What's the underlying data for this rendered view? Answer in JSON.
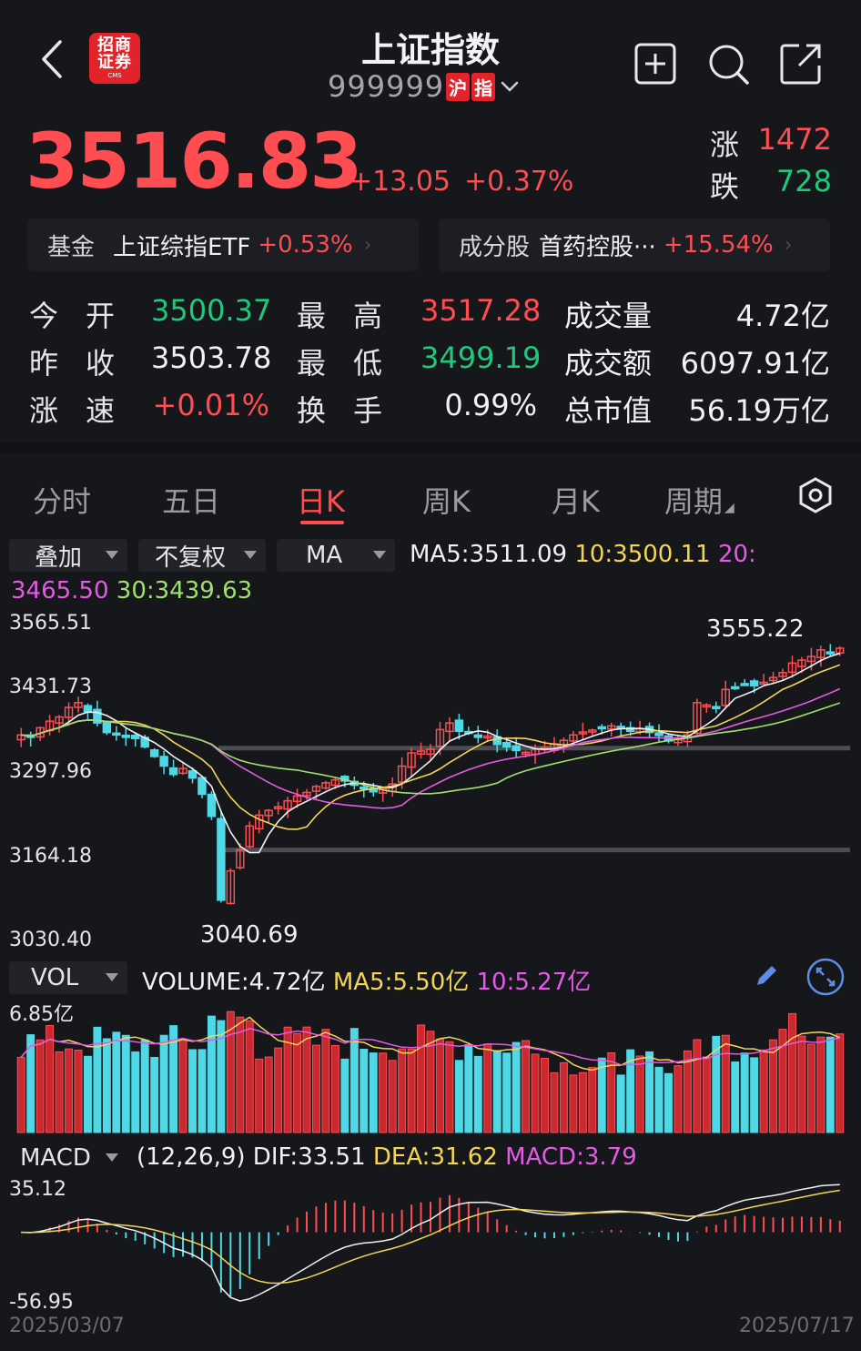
{
  "header": {
    "title": "上证指数",
    "code": "999999",
    "tag1": "沪",
    "tag2": "指",
    "logo_line1": "招商",
    "logo_line2": "证券",
    "logo_small": "CMS"
  },
  "quote": {
    "price": "3516.83",
    "change": "+13.05",
    "change_pct": "+0.37%",
    "up_label": "涨",
    "up_count": "1472",
    "down_label": "跌",
    "down_count": "728"
  },
  "fund": {
    "left_key": "基金",
    "left_name": "上证综指ETF",
    "left_value": "+0.53%",
    "right_key": "成分股",
    "right_name": "首药控股···",
    "right_value": "+15.54%"
  },
  "stats": {
    "open_label": "今开",
    "open_value": "3500.37",
    "high_label": "最高",
    "high_value": "3517.28",
    "vol_label": "成交量",
    "vol_value": "4.72亿",
    "prev_label": "昨收",
    "prev_value": "3503.78",
    "low_label": "最低",
    "low_value": "3499.19",
    "amount_label": "成交额",
    "amount_value": "6097.91亿",
    "speed_label": "涨速",
    "speed_value": "+0.01%",
    "turnover_label": "换手",
    "turnover_value": "0.99%",
    "mcap_label": "总市值",
    "mcap_value": "56.19万亿"
  },
  "tabs": [
    "分时",
    "五日",
    "日K",
    "周K",
    "月K",
    "周期"
  ],
  "active_tab": "日K",
  "kline_controls": {
    "overlay": "叠加",
    "adjust": "不复权",
    "ma": "MA",
    "ma5_label": "MA5:",
    "ma5_value": "3511.09",
    "ma10_label": "10:",
    "ma10_value": "3500.11",
    "ma20_label": "20:",
    "ma20_value": "3465.50",
    "ma30_label": "30:",
    "ma30_value": "3439.63"
  },
  "price_axis": [
    "3565.51",
    "3431.73",
    "3297.96",
    "3164.18",
    "3030.40"
  ],
  "price_annotations": {
    "high": "3555.22",
    "low": "3040.69"
  },
  "volume_panel": {
    "selector": "VOL",
    "volume_label": "VOLUME:",
    "volume_value": "4.72亿",
    "ma5_label": "MA5:",
    "ma5_value": "5.50亿",
    "ma10_label": "10:",
    "ma10_value": "5.27亿",
    "axis_top": "6.85亿"
  },
  "macd_panel": {
    "selector": "MACD",
    "params": "(12,26,9)",
    "dif_label": "DIF:",
    "dif_value": "33.51",
    "dea_label": "DEA:",
    "dea_value": "31.62",
    "macd_label": "MACD:",
    "macd_value": "3.79",
    "axis_top": "35.12",
    "axis_bottom": "-56.95"
  },
  "dates": {
    "start": "2025/03/07",
    "end": "2025/07/17"
  },
  "colors": {
    "up": "#ff4d52",
    "down": "#21c77a",
    "candle_down": "#4fd8e6",
    "ma5": "#f1f1f3",
    "ma10": "#f3d55a",
    "ma20": "#e45ae6",
    "ma30": "#9ee06e",
    "background": "#16171b"
  },
  "chart_data": {
    "type": "candlestick",
    "x_range": [
      "2025/03/07",
      "2025/07/17"
    ],
    "y_range": [
      3030.4,
      3565.51
    ],
    "closes": [
      3372,
      3368,
      3384,
      3395,
      3402,
      3418,
      3426,
      3410,
      3392,
      3376,
      3374,
      3368,
      3366,
      3352,
      3336,
      3320,
      3306,
      3316,
      3300,
      3273,
      3236,
      3096,
      3145,
      3180,
      3220,
      3238,
      3246,
      3252,
      3262,
      3270,
      3276,
      3286,
      3292,
      3297,
      3295,
      3288,
      3282,
      3277,
      3282,
      3290,
      3320,
      3342,
      3345,
      3348,
      3381,
      3392,
      3378,
      3375,
      3368,
      3370,
      3356,
      3352,
      3346,
      3343,
      3348,
      3351,
      3357,
      3363,
      3372,
      3377,
      3380,
      3384,
      3387,
      3384,
      3378,
      3382,
      3376,
      3371,
      3362,
      3364,
      3372,
      3426,
      3422,
      3418,
      3448,
      3452,
      3457,
      3454,
      3460,
      3468,
      3476,
      3492,
      3497,
      3503,
      3514,
      3510,
      3516
    ],
    "ma5_last": 3511.09,
    "ma10_last": 3500.11,
    "ma20_last": 3465.5,
    "ma30_last": 3439.63,
    "annotations": [
      {
        "label": "3555.22",
        "type": "high"
      },
      {
        "label": "3040.69",
        "type": "low"
      }
    ],
    "support_lines": [
      3350,
      3180
    ]
  }
}
